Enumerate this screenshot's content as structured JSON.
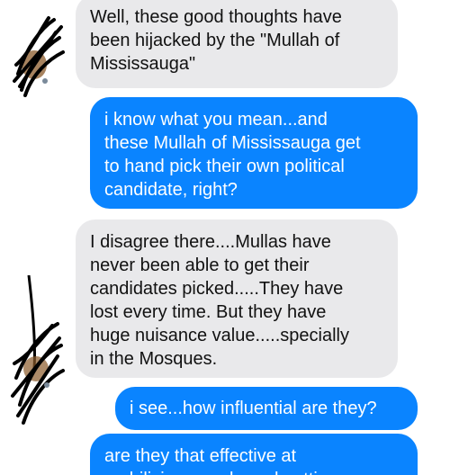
{
  "messages": [
    {
      "direction": "incoming",
      "text": "Well, these good thoughts have\nbeen hijacked by the \"Mullah of\nMississauga\""
    },
    {
      "direction": "outgoing",
      "text": "i know what you mean...and\nthese Mullah of Mississauga get\nto hand pick their own political\ncandidate, right?"
    },
    {
      "direction": "incoming",
      "text": "I disagree there....Mullas have\nnever been able to get their\ncandidates picked.....They have\nlost every time. But they have\nhuge nuisance value.....specially\nin the Mosques."
    },
    {
      "direction": "outgoing",
      "text": "i see...how influential are they?"
    },
    {
      "direction": "outgoing",
      "text": "are they that effective at\nmobilizing people and getting"
    }
  ],
  "colors": {
    "incoming_bubble": "#e9e9eb",
    "outgoing_bubble": "#0a84ff",
    "redaction": "#000000"
  },
  "icons": {
    "avatar_top": "redacted-avatar-icon",
    "avatar_bottom": "redacted-avatar-icon"
  }
}
